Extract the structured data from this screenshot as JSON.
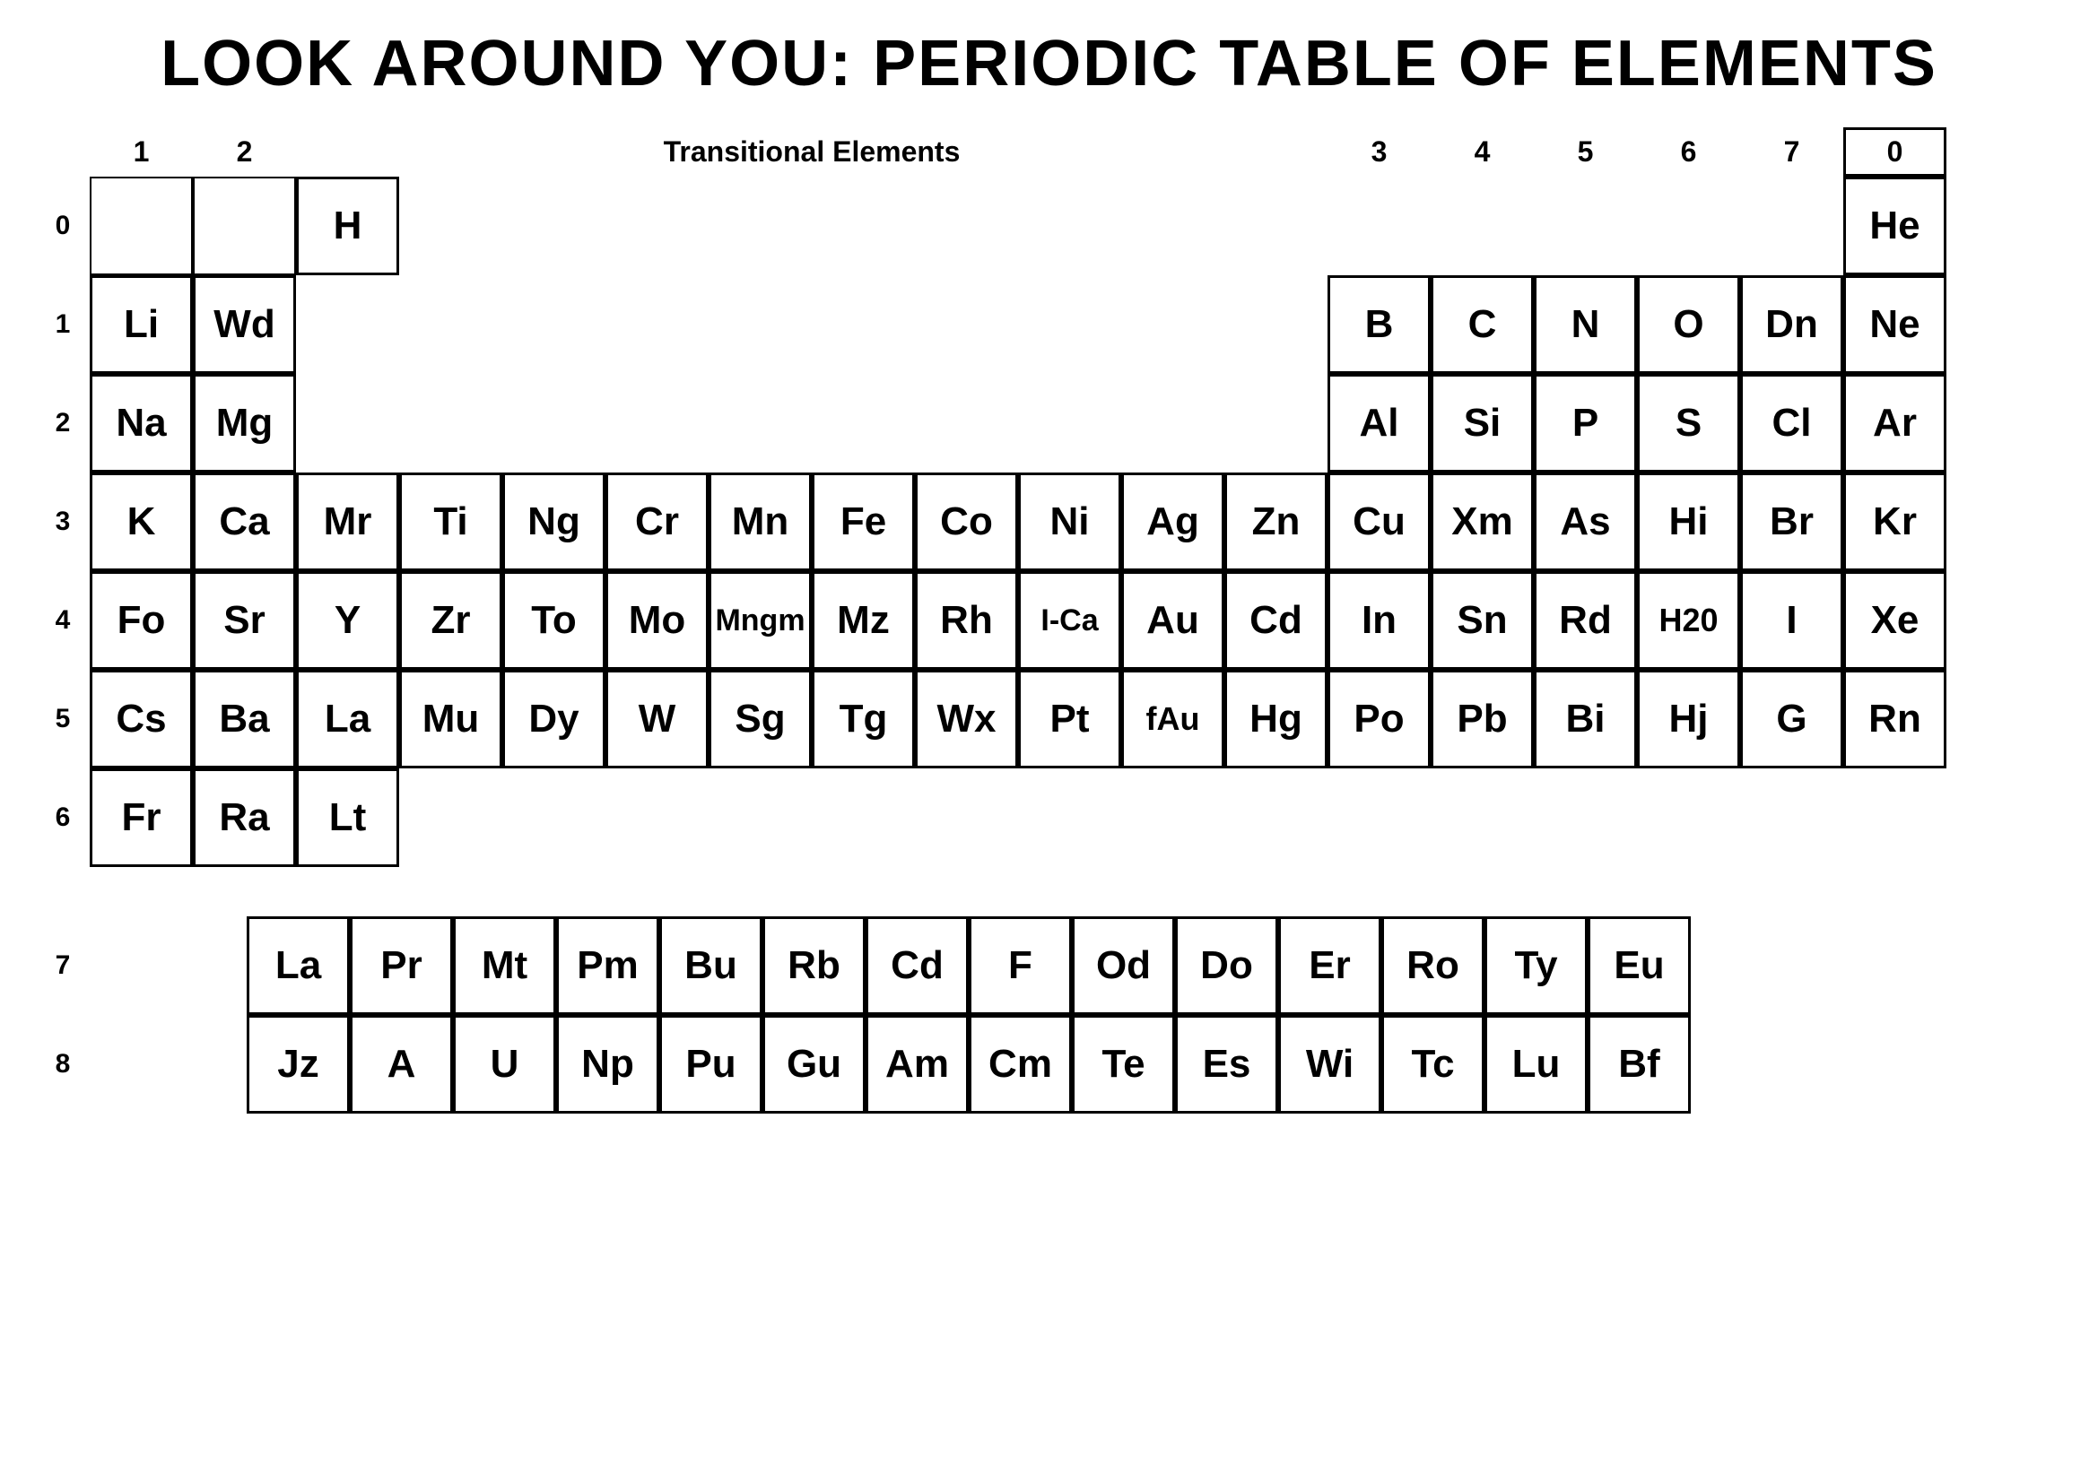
{
  "title": "LOOK AROUND YOU: PERIODIC TABLE OF ELEMENTS",
  "col_numbers": [
    "1",
    "2",
    "",
    "",
    "",
    "",
    "",
    "",
    "",
    "",
    "",
    "",
    "3",
    "4",
    "5",
    "6",
    "7",
    "0"
  ],
  "transitional_label": "Transitional Elements",
  "rows": [
    {
      "label": "0",
      "cells": [
        "",
        "",
        "H",
        "",
        "",
        "",
        "",
        "",
        "",
        "",
        "",
        "",
        "",
        "",
        "",
        "",
        "",
        "He"
      ]
    },
    {
      "label": "1",
      "cells": [
        "Li",
        "Wd",
        "",
        "",
        "",
        "",
        "",
        "",
        "",
        "",
        "",
        "",
        "B",
        "C",
        "N",
        "O",
        "Dn",
        "Ne"
      ]
    },
    {
      "label": "2",
      "cells": [
        "Na",
        "Mg",
        "",
        "",
        "",
        "",
        "",
        "",
        "",
        "",
        "",
        "",
        "Al",
        "Si",
        "P",
        "S",
        "Cl",
        "Ar"
      ]
    },
    {
      "label": "3",
      "cells": [
        "K",
        "Ca",
        "Mr",
        "Ti",
        "Ng",
        "Cr",
        "Mn",
        "Fe",
        "Co",
        "Ni",
        "Ag",
        "Zn",
        "Cu",
        "Xm",
        "As",
        "Hi",
        "Br",
        "Kr"
      ]
    },
    {
      "label": "4",
      "cells": [
        "Fo",
        "Sr",
        "Y",
        "Zr",
        "To",
        "Mo",
        "Mngm",
        "Mz",
        "Rh",
        "I-Ca",
        "Au",
        "Cd",
        "In",
        "Sn",
        "Rd",
        "H20",
        "I",
        "Xe"
      ]
    },
    {
      "label": "5",
      "cells": [
        "Cs",
        "Ba",
        "La",
        "Mu",
        "Dy",
        "W",
        "Sg",
        "Tg",
        "Wx",
        "Pt",
        "fAu",
        "Hg",
        "Po",
        "Pb",
        "Bi",
        "Hj",
        "G",
        "Rn"
      ]
    },
    {
      "label": "6",
      "cells": [
        "Fr",
        "Ra",
        "Lt",
        "",
        "",
        "",
        "",
        "",
        "",
        "",
        "",
        "",
        "",
        "",
        "",
        "",
        "",
        ""
      ]
    }
  ],
  "bottom_rows": [
    {
      "label": "7",
      "cells": [
        "La",
        "Pr",
        "Mt",
        "Pm",
        "Bu",
        "Rb",
        "Cd",
        "F",
        "Od",
        "Do",
        "Er",
        "Ro",
        "Ty",
        "Eu"
      ]
    },
    {
      "label": "8",
      "cells": [
        "Jz",
        "A",
        "U",
        "Np",
        "Pu",
        "Gu",
        "Am",
        "Cm",
        "Te",
        "Es",
        "Wi",
        "Tc",
        "Lu",
        "Bf"
      ]
    }
  ]
}
